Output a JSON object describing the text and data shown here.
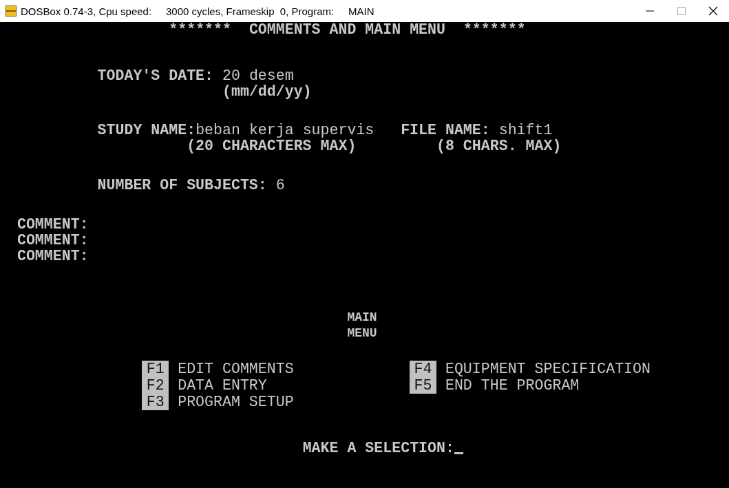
{
  "window": {
    "title": "DOSBox 0.74-3, Cpu speed:     3000 cycles, Frameskip  0, Program:     MAIN"
  },
  "screen": {
    "header": "*******  COMMENTS AND MAIN MENU  *******",
    "todays_date": {
      "label": "TODAY'S DATE:",
      "value": "20 desem",
      "hint": "(mm/dd/yy)"
    },
    "study_name": {
      "label": "STUDY NAME:",
      "value": "beban kerja supervis",
      "hint": "(20 CHARACTERS MAX)"
    },
    "file_name": {
      "label": "FILE NAME:",
      "value": "shift1",
      "hint": "(8 CHARS. MAX)"
    },
    "number_of_subjects": {
      "label": "NUMBER OF SUBJECTS:",
      "value": "6"
    },
    "comments": [
      "COMMENT:",
      "COMMENT:",
      "COMMENT:"
    ],
    "menu_title": [
      "MAIN",
      "MENU"
    ],
    "menu_left": [
      {
        "key": "F1",
        "label": "EDIT COMMENTS"
      },
      {
        "key": "F2",
        "label": "DATA ENTRY"
      },
      {
        "key": "F3",
        "label": "PROGRAM SETUP"
      }
    ],
    "menu_right": [
      {
        "key": "F4",
        "label": "EQUIPMENT SPECIFICATION"
      },
      {
        "key": "F5",
        "label": "END THE PROGRAM"
      }
    ],
    "prompt": "MAKE A SELECTION:"
  }
}
